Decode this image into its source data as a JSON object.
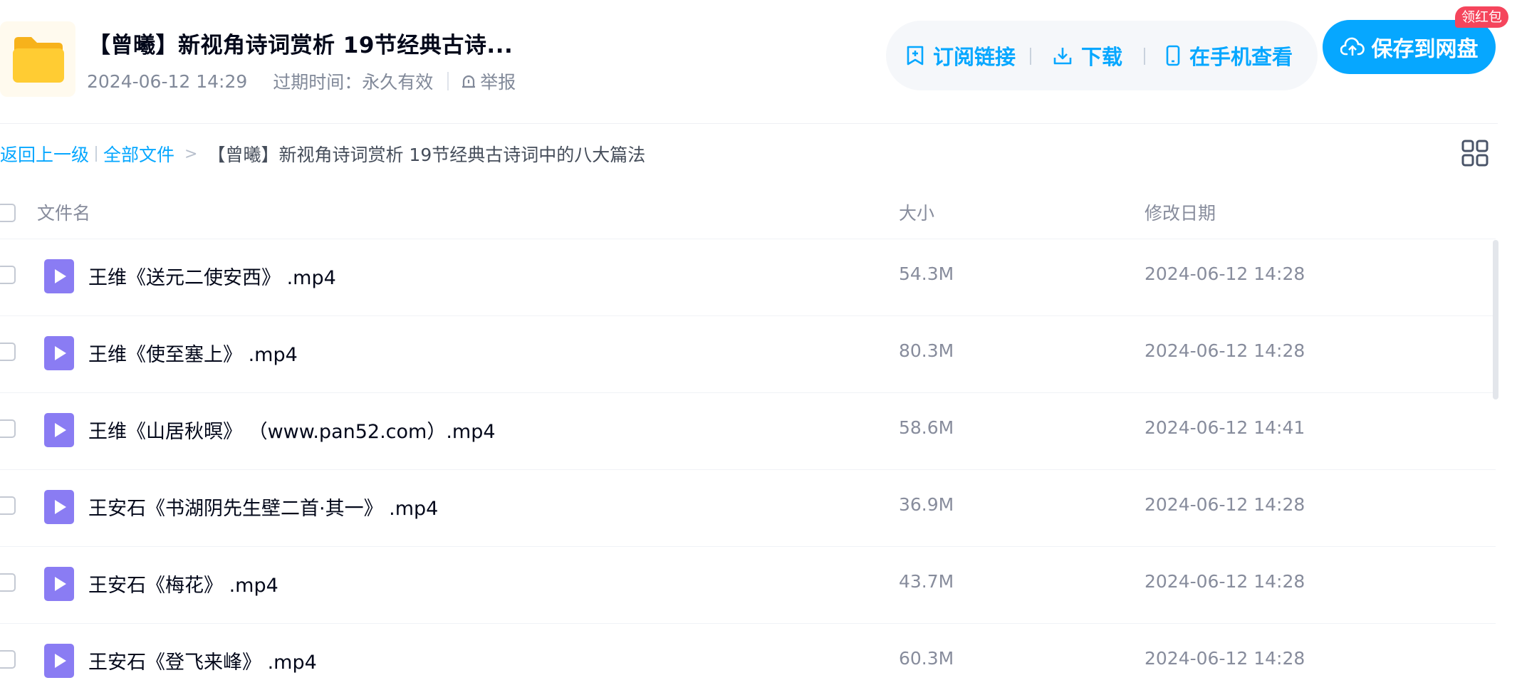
{
  "header": {
    "title": "【曾曦】新视角诗词赏析 19节经典古诗...",
    "share_time": "2024-06-12 14:29",
    "expire_label": "过期时间：永久有效",
    "report_label": "举报",
    "actions": {
      "subscribe": "订阅链接",
      "download": "下载",
      "mobile": "在手机查看",
      "save": "保存到网盘",
      "badge": "领红包"
    }
  },
  "breadcrumb": {
    "back": "返回上一级",
    "all_files": "全部文件",
    "separator": ">",
    "current": "【曾曦】新视角诗词赏析 19节经典古诗词中的八大篇法"
  },
  "table": {
    "columns": {
      "name": "文件名",
      "size": "大小",
      "date": "修改日期"
    },
    "rows": [
      {
        "name": "王维《送元二使安西》 .mp4",
        "size": "54.3M",
        "date": "2024-06-12 14:28"
      },
      {
        "name": "王维《使至塞上》 .mp4",
        "size": "80.3M",
        "date": "2024-06-12 14:28"
      },
      {
        "name": "王维《山居秋暝》 （www.pan52.com）.mp4",
        "size": "58.6M",
        "date": "2024-06-12 14:41"
      },
      {
        "name": "王安石《书湖阴先生壁二首·其一》 .mp4",
        "size": "36.9M",
        "date": "2024-06-12 14:28"
      },
      {
        "name": "王安石《梅花》 .mp4",
        "size": "43.7M",
        "date": "2024-06-12 14:28"
      },
      {
        "name": "王安石《登飞来峰》 .mp4",
        "size": "60.3M",
        "date": "2024-06-12 14:28"
      }
    ]
  },
  "icons": {
    "folder": "folder-icon",
    "video": "video-file-icon",
    "subscribe": "subscribe-icon",
    "download": "download-icon",
    "mobile": "phone-icon",
    "save": "cloud-upload-icon",
    "report": "report-icon",
    "view_toggle": "grid-view-icon"
  },
  "colors": {
    "accent": "#06a7ff",
    "badge": "#f5455c",
    "folder": "#ffc731",
    "video_icon": "#8a7cf3"
  }
}
